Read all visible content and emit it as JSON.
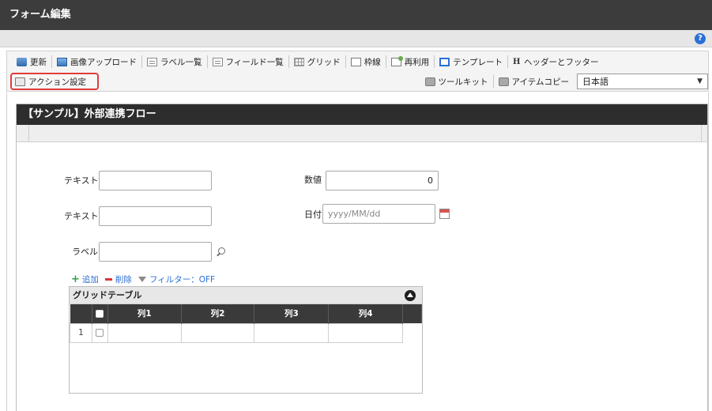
{
  "app": {
    "title": "フォーム編集"
  },
  "toolbar": {
    "row1": [
      {
        "label": "更新",
        "icon": "update-icon"
      },
      {
        "label": "画像アップロード",
        "icon": "image-upload-icon"
      },
      {
        "label": "ラベル一覧",
        "icon": "label-list-icon"
      },
      {
        "label": "フィールド一覧",
        "icon": "field-list-icon"
      },
      {
        "label": "グリッド",
        "icon": "grid-icon"
      },
      {
        "label": "枠線",
        "icon": "frame-icon"
      },
      {
        "label": "再利用",
        "icon": "reuse-icon"
      },
      {
        "label": "テンプレート",
        "icon": "template-icon"
      },
      {
        "label": "ヘッダーとフッター",
        "icon": "header-footer-icon"
      }
    ],
    "action_label": "アクション設定",
    "toolkit_label": "ツールキット",
    "item_copy_label": "アイテムコピー",
    "language": {
      "selected": "日本語"
    }
  },
  "form": {
    "title": "【サンプル】外部連携フロー",
    "fields": {
      "text1_label": "テキスト",
      "text1_value": "",
      "text2_label": "テキスト",
      "text2_value": "",
      "label_label": "ラベル",
      "label_value": "",
      "number_label": "数値",
      "number_value": "0",
      "date_label": "日付",
      "date_placeholder": "yyyy/MM/dd"
    },
    "grid_actions": {
      "add": "追加",
      "delete": "削除",
      "filter": "フィルター：OFF"
    },
    "grid": {
      "title": "グリッドテーブル",
      "columns": [
        "列1",
        "列2",
        "列3",
        "列4"
      ],
      "rows": [
        {
          "num": "1",
          "cells": [
            "",
            "",
            "",
            ""
          ]
        }
      ]
    }
  },
  "colors": {
    "highlight_border": "#e03c3c",
    "header_bg": "#2d2d2d",
    "link_blue": "#2b6fd6"
  }
}
